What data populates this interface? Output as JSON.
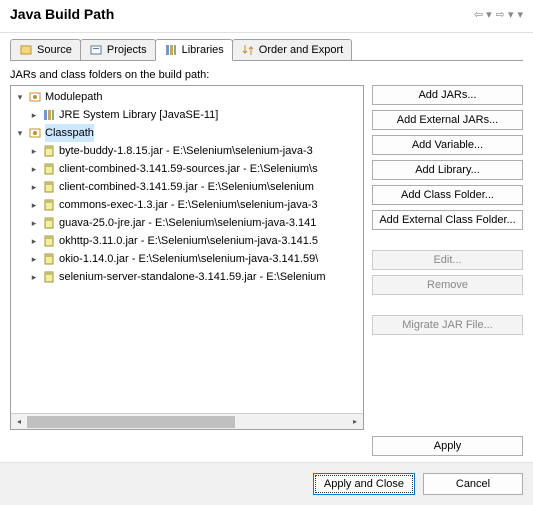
{
  "header": {
    "title": "Java Build Path"
  },
  "tabs": [
    {
      "label": "Source"
    },
    {
      "label": "Projects"
    },
    {
      "label": "Libraries"
    },
    {
      "label": "Order and Export"
    }
  ],
  "subtitle": "JARs and class folders on the build path:",
  "tree": {
    "modulepath": {
      "label": "Modulepath",
      "children": [
        {
          "label": "JRE System Library [JavaSE-11]"
        }
      ]
    },
    "classpath": {
      "label": "Classpath",
      "selected": true,
      "children": [
        {
          "label": "byte-buddy-1.8.15.jar - E:\\Selenium\\selenium-java-3"
        },
        {
          "label": "client-combined-3.141.59-sources.jar - E:\\Selenium\\s"
        },
        {
          "label": "client-combined-3.141.59.jar - E:\\Selenium\\selenium"
        },
        {
          "label": "commons-exec-1.3.jar - E:\\Selenium\\selenium-java-3"
        },
        {
          "label": "guava-25.0-jre.jar - E:\\Selenium\\selenium-java-3.141"
        },
        {
          "label": "okhttp-3.11.0.jar - E:\\Selenium\\selenium-java-3.141.5"
        },
        {
          "label": "okio-1.14.0.jar - E:\\Selenium\\selenium-java-3.141.59\\"
        },
        {
          "label": "selenium-server-standalone-3.141.59.jar - E:\\Selenium"
        }
      ]
    }
  },
  "buttons": {
    "add_jars": "Add JARs...",
    "add_external_jars": "Add External JARs...",
    "add_variable": "Add Variable...",
    "add_library": "Add Library...",
    "add_class_folder": "Add Class Folder...",
    "add_external_class_folder": "Add External Class Folder...",
    "edit": "Edit...",
    "remove": "Remove",
    "migrate_jar": "Migrate JAR File...",
    "apply": "Apply"
  },
  "footer": {
    "apply_close": "Apply and Close",
    "cancel": "Cancel"
  }
}
